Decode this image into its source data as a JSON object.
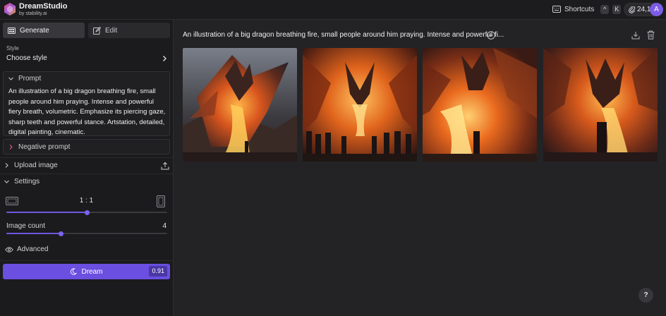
{
  "app": {
    "name": "DreamStudio",
    "byline": "by stability.ai"
  },
  "topbar": {
    "shortcuts_label": "Shortcuts",
    "shortcut_keys": [
      "^",
      "K"
    ],
    "credits": "24,1",
    "avatar_initial": "A"
  },
  "sidebar": {
    "tabs": [
      {
        "label": "Generate",
        "icon": "grid-icon",
        "active": true
      },
      {
        "label": "Edit",
        "icon": "edit-icon",
        "active": false
      }
    ],
    "style": {
      "label": "Style",
      "value": "Choose style"
    },
    "prompt": {
      "label": "Prompt",
      "text": "An illustration of a big dragon breathing fire, small people around him praying. Intense and powerful fiery breath, volumetric. Emphasize its piercing gaze, sharp teeth and powerful stance. Artstation, detailed, digital painting, cinematic."
    },
    "negative_prompt": {
      "label": "Negative prompt"
    },
    "upload_image": {
      "label": "Upload image"
    },
    "settings": {
      "label": "Settings",
      "aspect_ratio": "1 : 1",
      "aspect_ratio_slider": 0.5,
      "image_count_label": "Image count",
      "image_count": "4",
      "image_count_slider": 0.34
    },
    "advanced": {
      "label": "Advanced"
    },
    "dream": {
      "label": "Dream",
      "cost": "0.91"
    }
  },
  "main": {
    "prompt_title": "An illustration of a big dragon breathing fire, small people around him praying. Intense and powerful fi...",
    "images": [
      {
        "name": "dragon-image-1"
      },
      {
        "name": "dragon-image-2"
      },
      {
        "name": "dragon-image-3"
      },
      {
        "name": "dragon-image-4"
      }
    ],
    "help": "?"
  },
  "colors": {
    "accent": "#6a4fe0",
    "background": "#232325",
    "sidebar": "#1b1b1d"
  }
}
